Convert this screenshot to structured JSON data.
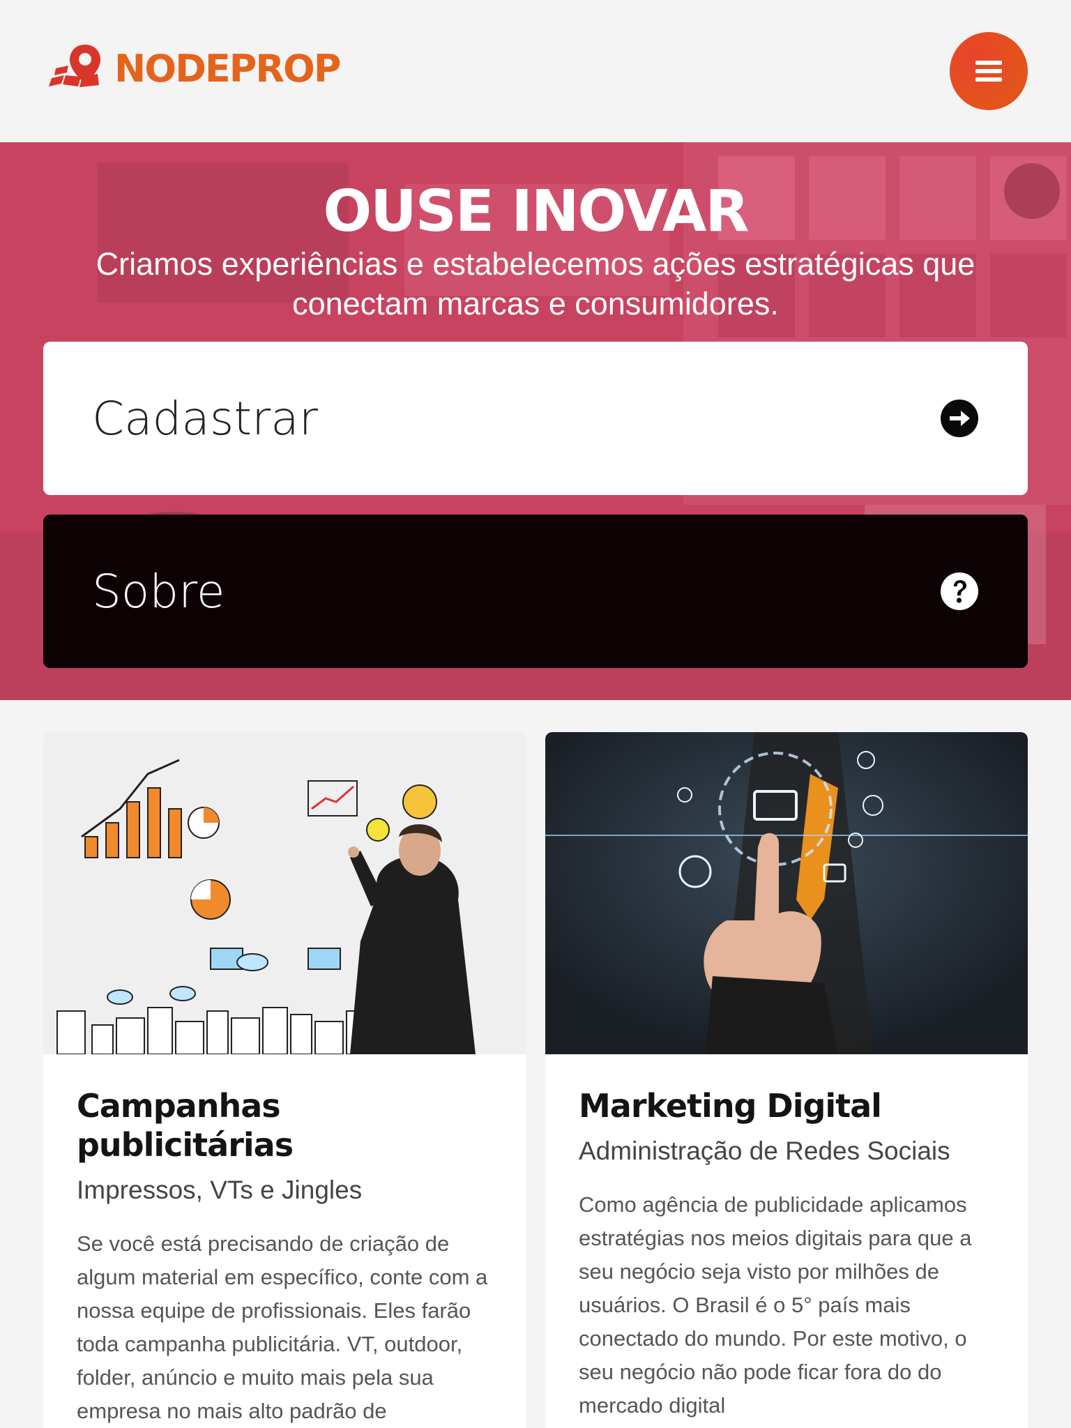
{
  "header": {
    "logo_text": "NODEPROP",
    "menu_icon": "menu-icon"
  },
  "hero": {
    "title": "OUSE INOVAR",
    "subtitle": "Criamos experiências e estabelecemos ações estratégicas que conectam marcas e consumidores."
  },
  "actions": {
    "cadastrar_label": "Cadastrar",
    "cadastrar_icon": "arrow-right-circle-icon",
    "sobre_label": "Sobre",
    "sobre_icon": "question-circle-icon"
  },
  "cards": [
    {
      "title": "Campanhas publicitárias",
      "subtitle": "Impressos, VTs e Jingles",
      "text": "Se você está precisando de criação de algum material em específico, conte com a nossa equipe de profissionais. Eles farão toda campanha publicitária. VT, outdoor, folder, anúncio e muito mais pela sua empresa no mais alto padrão de qualidade."
    },
    {
      "title": "Marketing Digital",
      "subtitle": "Administração de Redes Sociais",
      "text": "Como agência de publicidade aplicamos estratégias nos meios digitais para que a seu negócio seja visto por milhões de usuários. O Brasil é o 5° país mais conectado do mundo. Por este motivo, o seu negócio não pode ficar fora do do mercado digital"
    }
  ],
  "colors": {
    "brand_orange": "#e4641c",
    "brand_red": "#e3432c",
    "hero_pink": "#c8435f",
    "dark_button": "#0c0203"
  }
}
